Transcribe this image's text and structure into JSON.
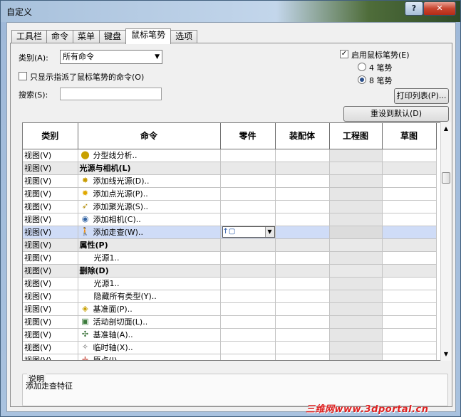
{
  "window": {
    "title": "自定义",
    "help_label": "?",
    "close_label": "✕"
  },
  "tabs": [
    "工具栏",
    "命令",
    "菜单",
    "键盘",
    "鼠标笔势",
    "选项"
  ],
  "active_tab": "鼠标笔势",
  "category": {
    "label": "类别(A):",
    "value": "所有命令"
  },
  "only_assigned": {
    "label": "只显示指派了鼠标笔势的命令(O)",
    "checked": false
  },
  "search": {
    "label": "搜索(S):",
    "value": ""
  },
  "gestures": {
    "enable_label": "启用鼠标笔势(E)",
    "enabled": true,
    "option4": "4 笔势",
    "option8": "8 笔势",
    "selected": "8 笔势"
  },
  "buttons": {
    "print_list": "打印列表(P)...",
    "reset_default": "重设到默认(D)"
  },
  "grid": {
    "headers": [
      "类别",
      "命令",
      "零件",
      "装配体",
      "工程图",
      "草图"
    ],
    "rows": [
      {
        "category": "视图(V)",
        "command": "分型线分析..",
        "icon": "parting-line-icon",
        "glyph": "⬤",
        "color": "#c8a000",
        "type": "item"
      },
      {
        "category": "视图(V)",
        "command": "光源与相机(L)",
        "type": "group"
      },
      {
        "category": "视图(V)",
        "command": "添加线光源(D)..",
        "icon": "directional-light-icon",
        "glyph": "✸",
        "color": "#c79b00",
        "type": "item"
      },
      {
        "category": "视图(V)",
        "command": "添加点光源(P)..",
        "icon": "point-light-icon",
        "glyph": "✹",
        "color": "#e0a800",
        "type": "item"
      },
      {
        "category": "视图(V)",
        "command": "添加聚光源(S)..",
        "icon": "spot-light-icon",
        "glyph": "➶",
        "color": "#b08800",
        "type": "item"
      },
      {
        "category": "视图(V)",
        "command": "添加相机(C)..",
        "icon": "camera-icon",
        "glyph": "◉",
        "color": "#3465a4",
        "type": "item"
      },
      {
        "category": "视图(V)",
        "command": "添加走查(W)..",
        "icon": "walkthrough-icon",
        "glyph": "🚶",
        "color": "#c0392b",
        "type": "selected",
        "gesture": "↑▢"
      },
      {
        "category": "视图(V)",
        "command": "属性(P)",
        "type": "group"
      },
      {
        "category": "视图(V)",
        "command": "光源1..",
        "type": "sub"
      },
      {
        "category": "视图(V)",
        "command": "删除(D)",
        "type": "group"
      },
      {
        "category": "视图(V)",
        "command": "光源1..",
        "type": "sub"
      },
      {
        "category": "视图(V)",
        "command": "隐藏所有类型(Y)..",
        "type": "sub"
      },
      {
        "category": "视图(V)",
        "command": "基准面(P)..",
        "icon": "plane-icon",
        "glyph": "◈",
        "color": "#c8a000",
        "type": "item"
      },
      {
        "category": "视图(V)",
        "command": "活动剖切面(L)..",
        "icon": "section-plane-icon",
        "glyph": "▣",
        "color": "#3a7a3a",
        "type": "item"
      },
      {
        "category": "视图(V)",
        "command": "基准轴(A)..",
        "icon": "axis-icon",
        "glyph": "✣",
        "color": "#2f6a2f",
        "type": "item"
      },
      {
        "category": "视图(V)",
        "command": "临时轴(X)..",
        "icon": "temp-axis-icon",
        "glyph": "✧",
        "color": "#666666",
        "type": "item"
      },
      {
        "category": "视图(V)",
        "command": "原点(I)..",
        "icon": "origin-icon",
        "glyph": "✛",
        "color": "#c0392b",
        "type": "item"
      }
    ]
  },
  "description": {
    "title": "说明",
    "text": "添加走查特征"
  },
  "watermark": "三维网www.3dportal.cn"
}
